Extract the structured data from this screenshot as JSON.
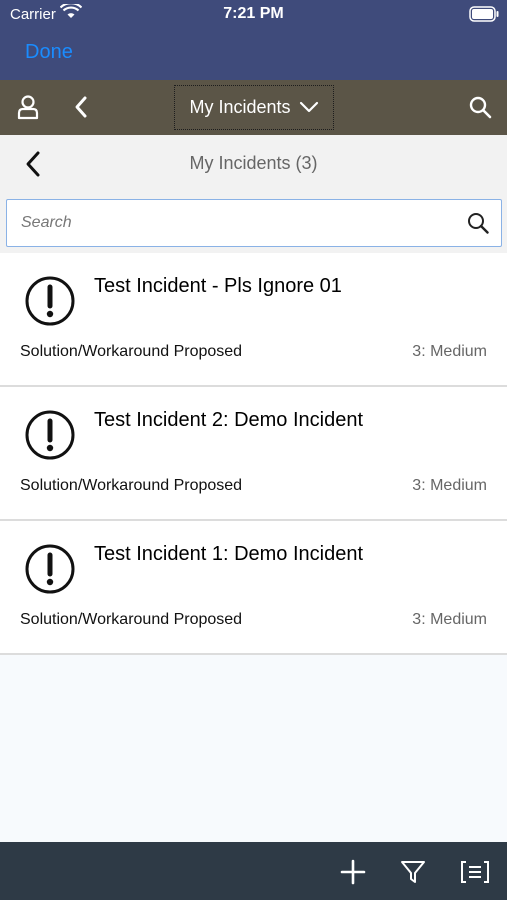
{
  "status_bar": {
    "carrier": "Carrier",
    "time": "7:21 PM"
  },
  "done_bar": {
    "done_label": "Done"
  },
  "header": {
    "title": "My Incidents",
    "icons": [
      "user-icon",
      "back-icon",
      "chevron-down-icon",
      "search-icon"
    ]
  },
  "list_header": {
    "title": "My Incidents (3)"
  },
  "search": {
    "placeholder": "Search"
  },
  "incidents": [
    {
      "title": "Test Incident - Pls Ignore 01",
      "status": "Solution/Workaround Proposed",
      "priority": "3: Medium",
      "icon": "exclamation-circle-icon"
    },
    {
      "title": "Test Incident 2: Demo Incident",
      "status": "Solution/Workaround Proposed",
      "priority": "3: Medium",
      "icon": "exclamation-circle-icon"
    },
    {
      "title": "Test Incident 1: Demo Incident",
      "status": "Solution/Workaround Proposed",
      "priority": "3: Medium",
      "icon": "exclamation-circle-icon"
    }
  ],
  "toolbar": {
    "icons": [
      "add-icon",
      "filter-icon",
      "list-view-icon"
    ]
  },
  "colors": {
    "nav_bg": "#3f4b7b",
    "header_bg": "#5b5547",
    "done_blue": "#1a8cff",
    "toolbar_bg": "#2e3a46"
  }
}
